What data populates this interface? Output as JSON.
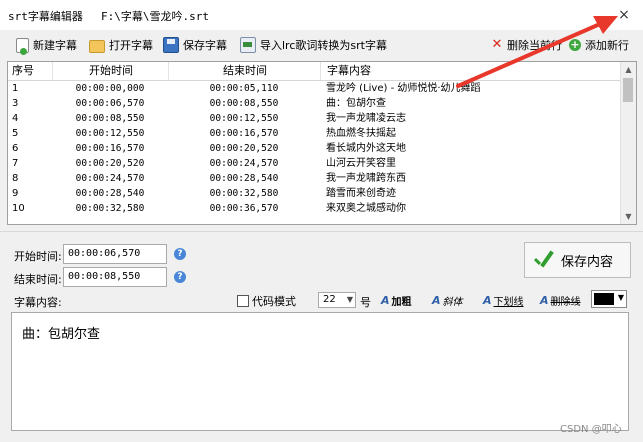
{
  "titlebar": {
    "app_title": "srt字幕编辑器",
    "file_path": "F:\\字幕\\雪龙吟.srt",
    "close_glyph": "×"
  },
  "toolbar": {
    "new_label": "新建字幕",
    "open_label": "打开字幕",
    "save_label": "保存字幕",
    "import_label": "导入lrc歌词转换为srt字幕",
    "delete_label": "删除当前行",
    "add_label": "添加新行"
  },
  "grid": {
    "columns": [
      "序号",
      "开始时间",
      "结束时间",
      "字幕内容"
    ],
    "rows": [
      {
        "no": "1",
        "start": "00:00:00,000",
        "end": "00:00:05,110",
        "text": "雪龙吟 (Live) - 幼师悦悦·幼儿舞蹈"
      },
      {
        "no": "3",
        "start": "00:00:06,570",
        "end": "00:00:08,550",
        "text": "曲：包胡尔查"
      },
      {
        "no": "4",
        "start": "00:00:08,550",
        "end": "00:00:12,550",
        "text": "我一声龙啸凌云志"
      },
      {
        "no": "5",
        "start": "00:00:12,550",
        "end": "00:00:16,570",
        "text": "热血燃冬扶摇起"
      },
      {
        "no": "6",
        "start": "00:00:16,570",
        "end": "00:00:20,520",
        "text": "看长城内外这天地"
      },
      {
        "no": "7",
        "start": "00:00:20,520",
        "end": "00:00:24,570",
        "text": "山河云开笑容里"
      },
      {
        "no": "8",
        "start": "00:00:24,570",
        "end": "00:00:28,540",
        "text": "我一声龙啸跨东西"
      },
      {
        "no": "9",
        "start": "00:00:28,540",
        "end": "00:00:32,580",
        "text": "踏雪而来创奇迹"
      },
      {
        "no": "10",
        "start": "00:00:32,580",
        "end": "00:00:36,570",
        "text": "来双奥之城感动你"
      }
    ]
  },
  "editor": {
    "start_label": "开始时间:",
    "start_value": "00:00:06,570",
    "end_label": "结束时间:",
    "end_value": "00:00:08,550",
    "content_label": "字幕内容:",
    "save_content_label": "保存内容",
    "code_mode_label": "代码模式",
    "font_size_value": "22",
    "font_size_unit": "号",
    "bold_label": "加粗",
    "italic_label": "斜体",
    "underline_label": "下划线",
    "strike_label": "删除线",
    "text_color": "#000000",
    "content_text": "曲：包胡尔查"
  },
  "watermark": "CSDN @叩心",
  "colors": {
    "arrow": "#e8372b",
    "accent_blue": "#3d74c2"
  }
}
